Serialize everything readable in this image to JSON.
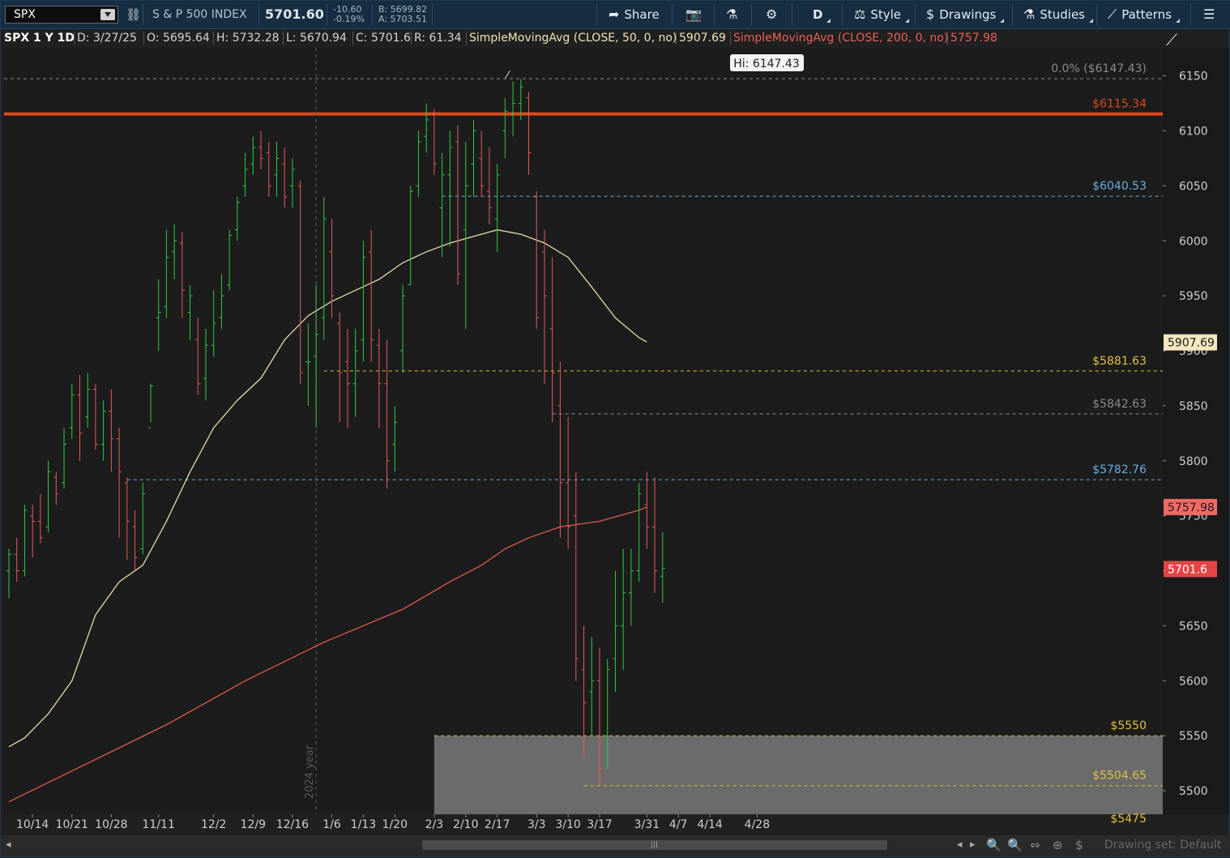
{
  "toolbar": {
    "symbol": "SPX",
    "name": "S & P 500 INDEX",
    "last": "5701.60",
    "change": "-10.60",
    "change_pct": "-0.19%",
    "bid": "B: 5699.82",
    "ask": "A: 5703.51",
    "share_label": "Share",
    "timeframe_label": "D",
    "style_label": "Style",
    "drawings_label": "Drawings",
    "studies_label": "Studies",
    "patterns_label": "Patterns"
  },
  "info": {
    "title": "SPX 1 Y 1D",
    "date": "D: 3/27/25",
    "open": "O: 5695.64",
    "high": "H: 5732.28",
    "low": "L: 5670.94",
    "close": "C: 5701.6",
    "range": "R: 61.34",
    "sma50_label": "SimpleMovingAvg (CLOSE, 50, 0, no)",
    "sma50_value": "5907.69",
    "sma200_label": "SimpleMovingAvg (CLOSE, 200, 0, no)",
    "sma200_value": "5757.98"
  },
  "footer": {
    "drawing_set": "Drawing set: Default"
  },
  "colors": {
    "up": "#2ecc40",
    "down": "#e85a5a",
    "sma50": "#e8d9a8",
    "sma200": "#e05a4e",
    "resistance": "#d94a1e",
    "blue_level": "#6aaee0",
    "yellow_level": "#e0c040",
    "gray_level": "#8a8a8a"
  },
  "chart_data": {
    "type": "ohlc-bar",
    "ylim": [
      5485,
      6170
    ],
    "y_ticks": [
      5500,
      5550,
      5600,
      5650,
      5700,
      5750,
      5800,
      5850,
      5900,
      5950,
      6000,
      6050,
      6100,
      6150
    ],
    "x_tick_labels": [
      "10/14",
      "10/21",
      "10/28",
      "11/11",
      "12/2",
      "12/9",
      "12/16",
      "1/6",
      "1/13",
      "1/20",
      "2/3",
      "2/10",
      "2/17",
      "3/3",
      "3/10",
      "3/17",
      "3/31",
      "4/7",
      "4/14",
      "4/28"
    ],
    "x_tick_bar_index": [
      3,
      8,
      13,
      19,
      26,
      31,
      36,
      41,
      45,
      49,
      54,
      58,
      62,
      67,
      71,
      75,
      81,
      85,
      89,
      95
    ],
    "year_marker": {
      "label": "2024 year",
      "bar_index": 39
    },
    "high_marker": {
      "label": "Hi: 6147.43",
      "bar_index": 63,
      "value": 6147.43
    },
    "levels": [
      {
        "label": "0.0% ($6147.43)",
        "value": 6147.43,
        "style": "gray",
        "start_bar": 0
      },
      {
        "label": "$6115.34",
        "value": 6115.34,
        "style": "resistance",
        "start_bar": 0
      },
      {
        "label": "$6040.53",
        "value": 6040.53,
        "style": "blue",
        "start_bar": 55
      },
      {
        "label": "$5881.63",
        "value": 5881.63,
        "style": "yellow",
        "start_bar": 40
      },
      {
        "label": "$5842.63",
        "value": 5842.63,
        "style": "gray",
        "start_bar": 69
      },
      {
        "label": "$5782.76",
        "value": 5782.76,
        "style": "blue",
        "start_bar": 15
      },
      {
        "label": "$5550",
        "value": 5550,
        "style": "yellow",
        "start_bar": 54
      },
      {
        "label": "$5504.65",
        "value": 5504.65,
        "style": "yellow",
        "start_bar": 73
      }
    ],
    "zone": {
      "from": 5475,
      "to": 5550,
      "start_bar": 54,
      "bottom_label": "$5475"
    },
    "price_tags": [
      {
        "label": "5907.69",
        "value": 5907.69,
        "kind": "sma50"
      },
      {
        "label": "5757.98",
        "value": 5757.98,
        "kind": "sma200"
      },
      {
        "label": "5701.6",
        "value": 5701.6,
        "kind": "last"
      }
    ],
    "ohlc": [
      [
        5700,
        5720,
        5675,
        5715
      ],
      [
        5715,
        5730,
        5690,
        5700
      ],
      [
        5700,
        5760,
        5695,
        5755
      ],
      [
        5750,
        5760,
        5712,
        5745
      ],
      [
        5745,
        5770,
        5725,
        5730
      ],
      [
        5740,
        5800,
        5735,
        5790
      ],
      [
        5785,
        5790,
        5760,
        5770
      ],
      [
        5780,
        5830,
        5775,
        5815
      ],
      [
        5830,
        5870,
        5820,
        5860
      ],
      [
        5860,
        5878,
        5800,
        5825
      ],
      [
        5840,
        5880,
        5830,
        5865
      ],
      [
        5865,
        5870,
        5810,
        5815
      ],
      [
        5815,
        5855,
        5800,
        5845
      ],
      [
        5845,
        5865,
        5790,
        5820
      ],
      [
        5820,
        5830,
        5730,
        5790
      ],
      [
        5780,
        5785,
        5710,
        5745
      ],
      [
        5740,
        5755,
        5700,
        5712
      ],
      [
        5720,
        5780,
        5715,
        5770
      ],
      [
        5830,
        5870,
        5835,
        5868
      ],
      [
        5930,
        5965,
        5900,
        5935
      ],
      [
        5940,
        6010,
        5930,
        5985
      ],
      [
        5990,
        6015,
        5965,
        6000
      ],
      [
        5998,
        6008,
        5930,
        5955
      ],
      [
        5935,
        5960,
        5910,
        5950
      ],
      [
        5910,
        5930,
        5860,
        5870
      ],
      [
        5875,
        5920,
        5855,
        5905
      ],
      [
        5905,
        5955,
        5895,
        5925
      ],
      [
        5930,
        5970,
        5920,
        5950
      ],
      [
        5960,
        6010,
        5955,
        6005
      ],
      [
        6010,
        6040,
        6000,
        6035
      ],
      [
        6050,
        6080,
        6040,
        6065
      ],
      [
        6070,
        6095,
        6060,
        6085
      ],
      [
        6085,
        6100,
        6065,
        6075
      ],
      [
        6080,
        6090,
        6040,
        6050
      ],
      [
        6060,
        6090,
        6040,
        6075
      ],
      [
        6070,
        6085,
        6030,
        6040
      ],
      [
        6050,
        6075,
        6030,
        6065
      ],
      [
        6050,
        6055,
        5870,
        5880
      ],
      [
        5890,
        5925,
        5850,
        5890
      ],
      [
        5895,
        5960,
        5830,
        5915
      ],
      [
        5930,
        6040,
        5910,
        6020
      ],
      [
        5990,
        6020,
        5930,
        5950
      ],
      [
        5925,
        5935,
        5835,
        5880
      ],
      [
        5890,
        5920,
        5830,
        5870
      ],
      [
        5870,
        5920,
        5840,
        5900
      ],
      [
        5910,
        6000,
        5890,
        5985
      ],
      [
        5990,
        6010,
        5890,
        5910
      ],
      [
        5905,
        5920,
        5830,
        5870
      ],
      [
        5870,
        5910,
        5775,
        5800
      ],
      [
        5815,
        5850,
        5790,
        5835
      ],
      [
        5900,
        5960,
        5880,
        5950
      ],
      [
        5960,
        6050,
        5960,
        6045
      ],
      [
        6050,
        6100,
        6040,
        6090
      ],
      [
        6095,
        6125,
        6080,
        6110
      ],
      [
        6115,
        6120,
        6060,
        6070
      ],
      [
        6030,
        6080,
        5985,
        6060
      ],
      [
        6060,
        6100,
        5995,
        6085
      ],
      [
        6090,
        6105,
        5960,
        5970
      ],
      [
        6010,
        6090,
        5920,
        6050
      ],
      [
        6070,
        6110,
        6040,
        6100
      ],
      [
        6075,
        6100,
        6040,
        6050
      ],
      [
        6045,
        6085,
        6015,
        6030
      ],
      [
        6020,
        6070,
        5990,
        6060
      ],
      [
        6100,
        6130,
        6075,
        6118
      ],
      [
        6115,
        6145,
        6095,
        6125
      ],
      [
        6125,
        6147,
        6110,
        6140
      ],
      [
        6130,
        6135,
        6060,
        6080
      ],
      [
        6040,
        6045,
        5920,
        5930
      ],
      [
        5990,
        6010,
        5870,
        5950
      ],
      [
        5920,
        5985,
        5835,
        5880
      ],
      [
        5850,
        5890,
        5730,
        5780
      ],
      [
        5780,
        5840,
        5720,
        5740
      ],
      [
        5750,
        5790,
        5600,
        5620
      ],
      [
        5610,
        5650,
        5530,
        5580
      ],
      [
        5590,
        5640,
        5550,
        5600
      ],
      [
        5600,
        5630,
        5505,
        5520
      ],
      [
        5550,
        5620,
        5520,
        5610
      ],
      [
        5620,
        5700,
        5590,
        5650
      ],
      [
        5650,
        5720,
        5610,
        5680
      ],
      [
        5680,
        5720,
        5650,
        5700
      ],
      [
        5700,
        5780,
        5690,
        5770
      ],
      [
        5760,
        5790,
        5720,
        5740
      ],
      [
        5740,
        5785,
        5680,
        5700
      ],
      [
        5695,
        5735,
        5671,
        5702
      ]
    ],
    "sma50": [
      [
        0,
        5540
      ],
      [
        2,
        5548
      ],
      [
        5,
        5570
      ],
      [
        8,
        5600
      ],
      [
        11,
        5660
      ],
      [
        14,
        5690
      ],
      [
        17,
        5705
      ],
      [
        20,
        5745
      ],
      [
        23,
        5790
      ],
      [
        26,
        5830
      ],
      [
        29,
        5855
      ],
      [
        32,
        5875
      ],
      [
        35,
        5910
      ],
      [
        38,
        5932
      ],
      [
        41,
        5945
      ],
      [
        44,
        5955
      ],
      [
        47,
        5965
      ],
      [
        50,
        5980
      ],
      [
        53,
        5990
      ],
      [
        56,
        5998
      ],
      [
        59,
        6004
      ],
      [
        62,
        6010
      ],
      [
        65,
        6006
      ],
      [
        68,
        5998
      ],
      [
        71,
        5985
      ],
      [
        74,
        5958
      ],
      [
        77,
        5930
      ],
      [
        80,
        5912
      ],
      [
        81,
        5908
      ]
    ],
    "sma200": [
      [
        0,
        5490
      ],
      [
        10,
        5525
      ],
      [
        20,
        5560
      ],
      [
        30,
        5600
      ],
      [
        40,
        5635
      ],
      [
        50,
        5665
      ],
      [
        56,
        5690
      ],
      [
        60,
        5705
      ],
      [
        63,
        5720
      ],
      [
        66,
        5730
      ],
      [
        70,
        5740
      ],
      [
        75,
        5745
      ],
      [
        80,
        5755
      ],
      [
        81,
        5758
      ]
    ]
  }
}
